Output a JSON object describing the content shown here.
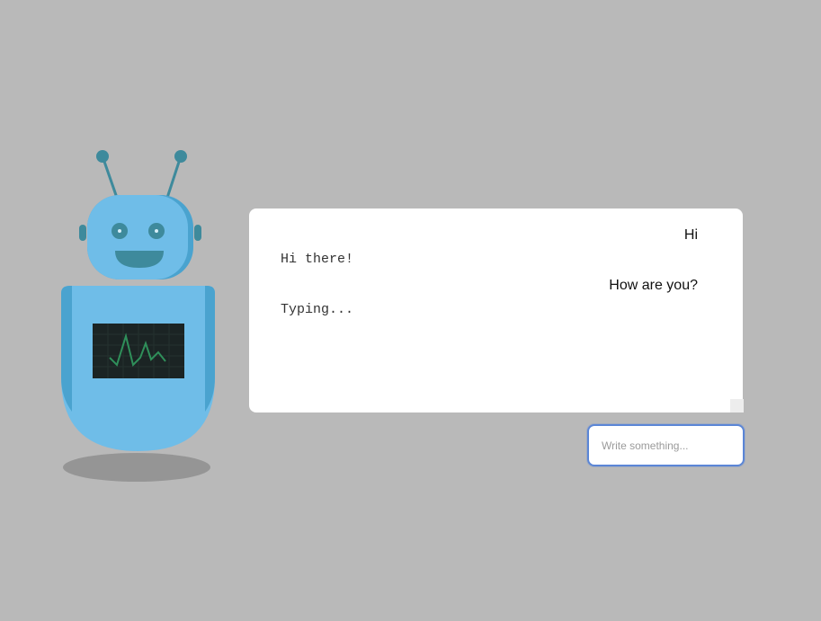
{
  "chat": {
    "messages": [
      {
        "sender": "user",
        "text": "Hi"
      },
      {
        "sender": "bot",
        "text": "Hi there!"
      },
      {
        "sender": "user",
        "text": "How are you?"
      },
      {
        "sender": "bot",
        "text": "Typing..."
      }
    ]
  },
  "input": {
    "placeholder": "Write something...",
    "value": ""
  },
  "colors": {
    "background": "#b9b9b9",
    "robot_body": "#6fbde8",
    "robot_shade": "#4aa3cf",
    "robot_dark": "#3e8a9c",
    "screen": "#1b2424",
    "screen_line": "#2f8f5a",
    "input_border": "#5b86d6"
  }
}
